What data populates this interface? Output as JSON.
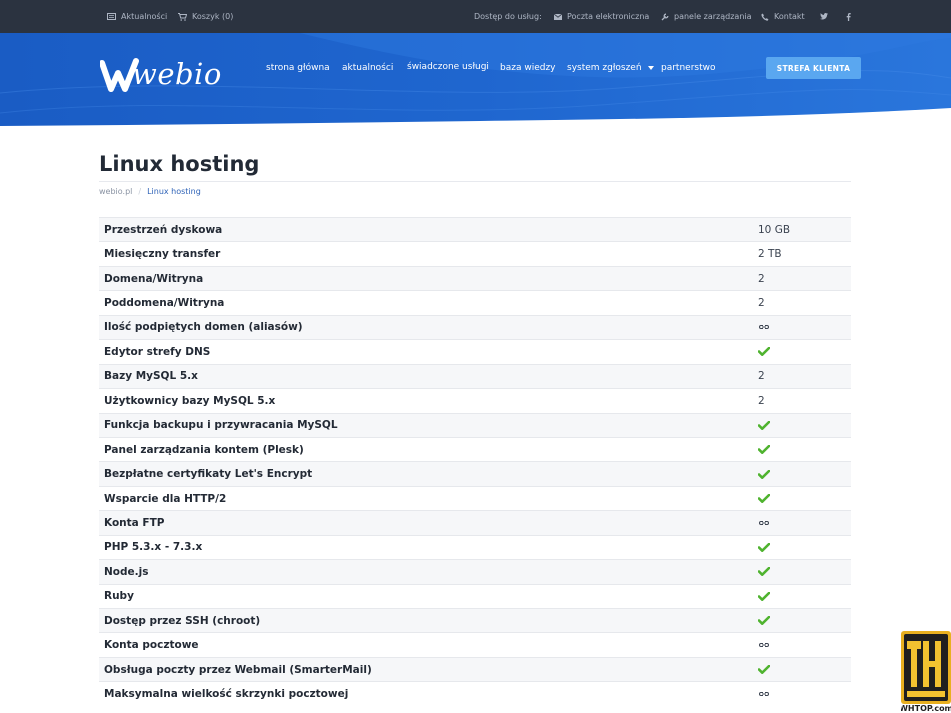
{
  "topbar": {
    "news": "Aktualności",
    "cart": "Koszyk (0)",
    "access": "Dostęp do usług:",
    "email": "Poczta elektroniczna",
    "panels": "panele zarządzania",
    "contact": "Kontakt"
  },
  "header": {
    "logo_text": "webio",
    "nav": [
      "strona główna",
      "aktualności",
      "świadczone usługi",
      "baza wiedzy",
      "system zgłoszeń",
      "partnerstwo"
    ],
    "cta": "STREFA KLIENTA"
  },
  "page": {
    "title": "Linux hosting",
    "breadcrumb": {
      "home": "webio.pl",
      "current": "Linux hosting"
    }
  },
  "specs": [
    {
      "label": "Przestrzeń dyskowa",
      "value": "10 GB"
    },
    {
      "label": "Miesięczny transfer",
      "value": "2 TB"
    },
    {
      "label": "Domena/Witryna",
      "value": "2"
    },
    {
      "label": "Poddomena/Witryna",
      "value": "2"
    },
    {
      "label": "Ilość podpiętych domen (aliasów)",
      "icon": "infinity-icon"
    },
    {
      "label": "Edytor strefy DNS",
      "icon": "check-icon"
    },
    {
      "label": "Bazy MySQL 5.x",
      "value": "2"
    },
    {
      "label": "Użytkownicy bazy MySQL 5.x",
      "value": "2"
    },
    {
      "label": "Funkcja backupu i przywracania MySQL",
      "icon": "check-icon"
    },
    {
      "label": "Panel zarządzania kontem (Plesk)",
      "icon": "check-icon"
    },
    {
      "label": "Bezpłatne certyfikaty Let's Encrypt",
      "icon": "check-icon"
    },
    {
      "label": "Wsparcie dla HTTP/2",
      "icon": "check-icon"
    },
    {
      "label": "Konta FTP",
      "icon": "infinity-icon"
    },
    {
      "label": "PHP 5.3.x - 7.3.x",
      "icon": "check-icon"
    },
    {
      "label": "Node.js",
      "icon": "check-icon"
    },
    {
      "label": "Ruby",
      "icon": "check-icon"
    },
    {
      "label": "Dostęp przez SSH (chroot)",
      "icon": "check-icon"
    },
    {
      "label": "Konta pocztowe",
      "icon": "infinity-icon"
    },
    {
      "label": "Obsługa poczty przez Webmail (SmarterMail)",
      "icon": "check-icon"
    },
    {
      "label": "Maksymalna wielkość skrzynki pocztowej",
      "icon": "infinity-icon"
    }
  ],
  "watermark": {
    "label": "WHTOP.com"
  },
  "colors": {
    "topbar_bg": "#2b3340",
    "header_blue": "#1d63c9",
    "cta_bg": "#5aa7f0",
    "check_green": "#4fb32f",
    "breadcrumb_link": "#2f63b7"
  }
}
